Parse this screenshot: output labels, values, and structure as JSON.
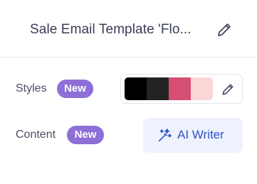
{
  "header": {
    "title": "Sale Email Template 'Flo...",
    "edit_icon": "pencil-icon"
  },
  "styles": {
    "label": "Styles",
    "badge": "New",
    "colors": [
      "#000000",
      "#232323",
      "#d64f72",
      "#fcd6d6"
    ],
    "edit_icon": "pencil-icon"
  },
  "content": {
    "label": "Content",
    "badge": "New",
    "ai_button": {
      "label": "AI Writer",
      "icon": "magic-wand-icon"
    }
  },
  "colors": {
    "badge_bg": "#8e6fd8",
    "accent": "#2f52c9",
    "ai_button_bg": "#eef2fd"
  }
}
